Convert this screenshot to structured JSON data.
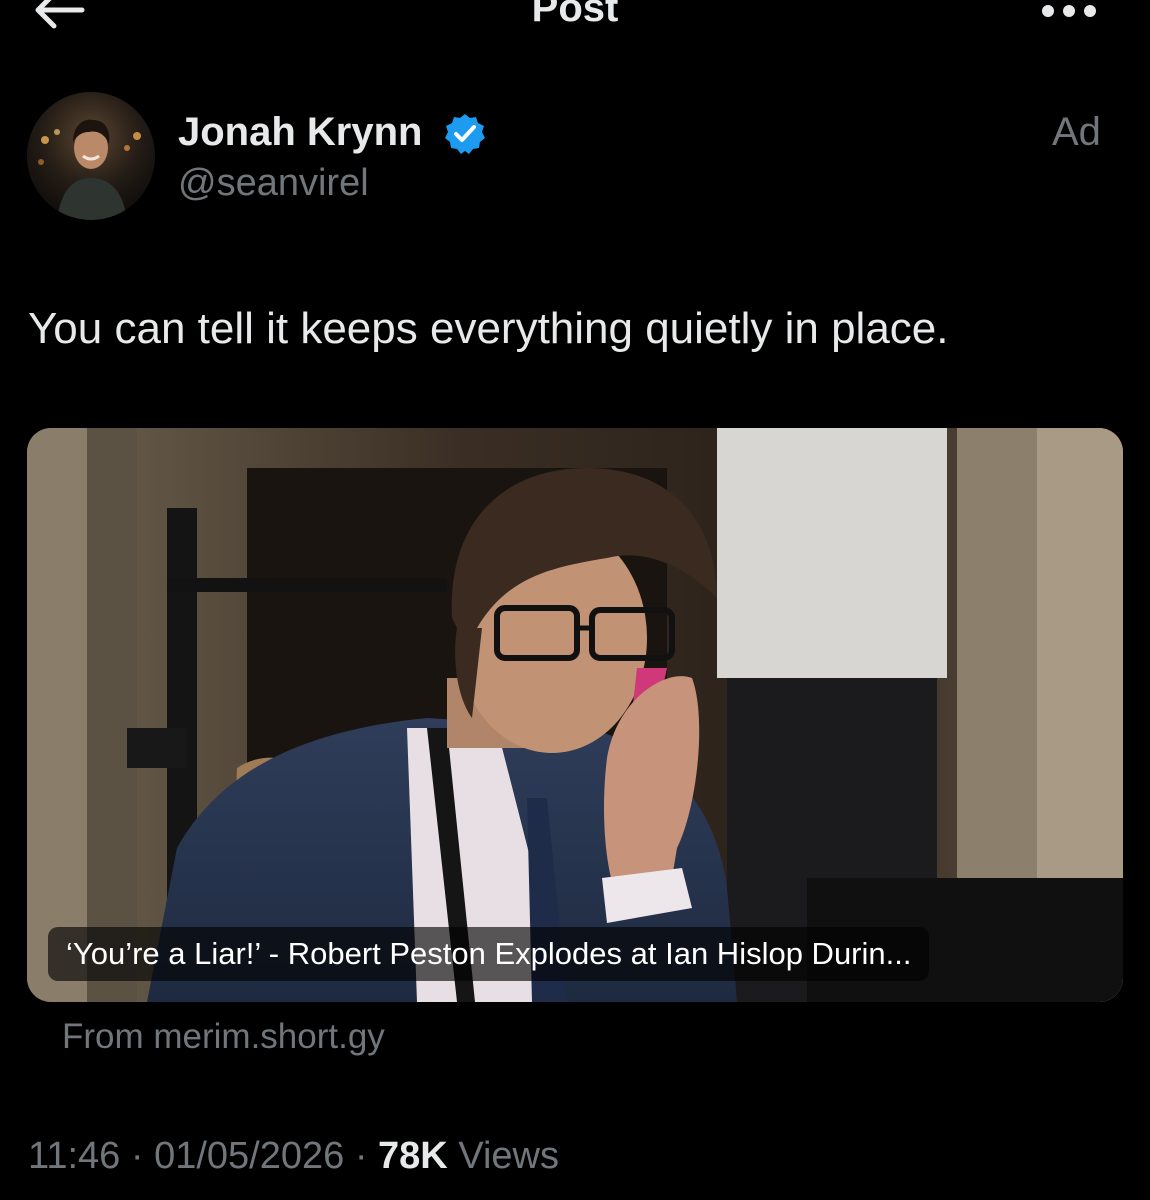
{
  "header": {
    "title": "Post",
    "back_icon": "arrow-left-icon",
    "more_icon": "more-horizontal-icon"
  },
  "author": {
    "name": "Jonah Krynn",
    "handle": "@seanvirel",
    "verified": true,
    "badge_color": "#1d9bf0"
  },
  "ad_label": "Ad",
  "post": {
    "text": "You can tell it keeps everything quietly in place."
  },
  "card": {
    "caption": "‘You’re a Liar!’ - Robert Peston Explodes at Ian Hislop Durin...",
    "source": "From merim.short.gy"
  },
  "meta": {
    "time": "11:46",
    "separator": "·",
    "date": "01/05/2026",
    "views_count": "78K",
    "views_label": "Views"
  },
  "colors": {
    "background": "#000000",
    "primary_text": "#e7e9ea",
    "secondary_text": "#71767b",
    "accent": "#1d9bf0"
  }
}
